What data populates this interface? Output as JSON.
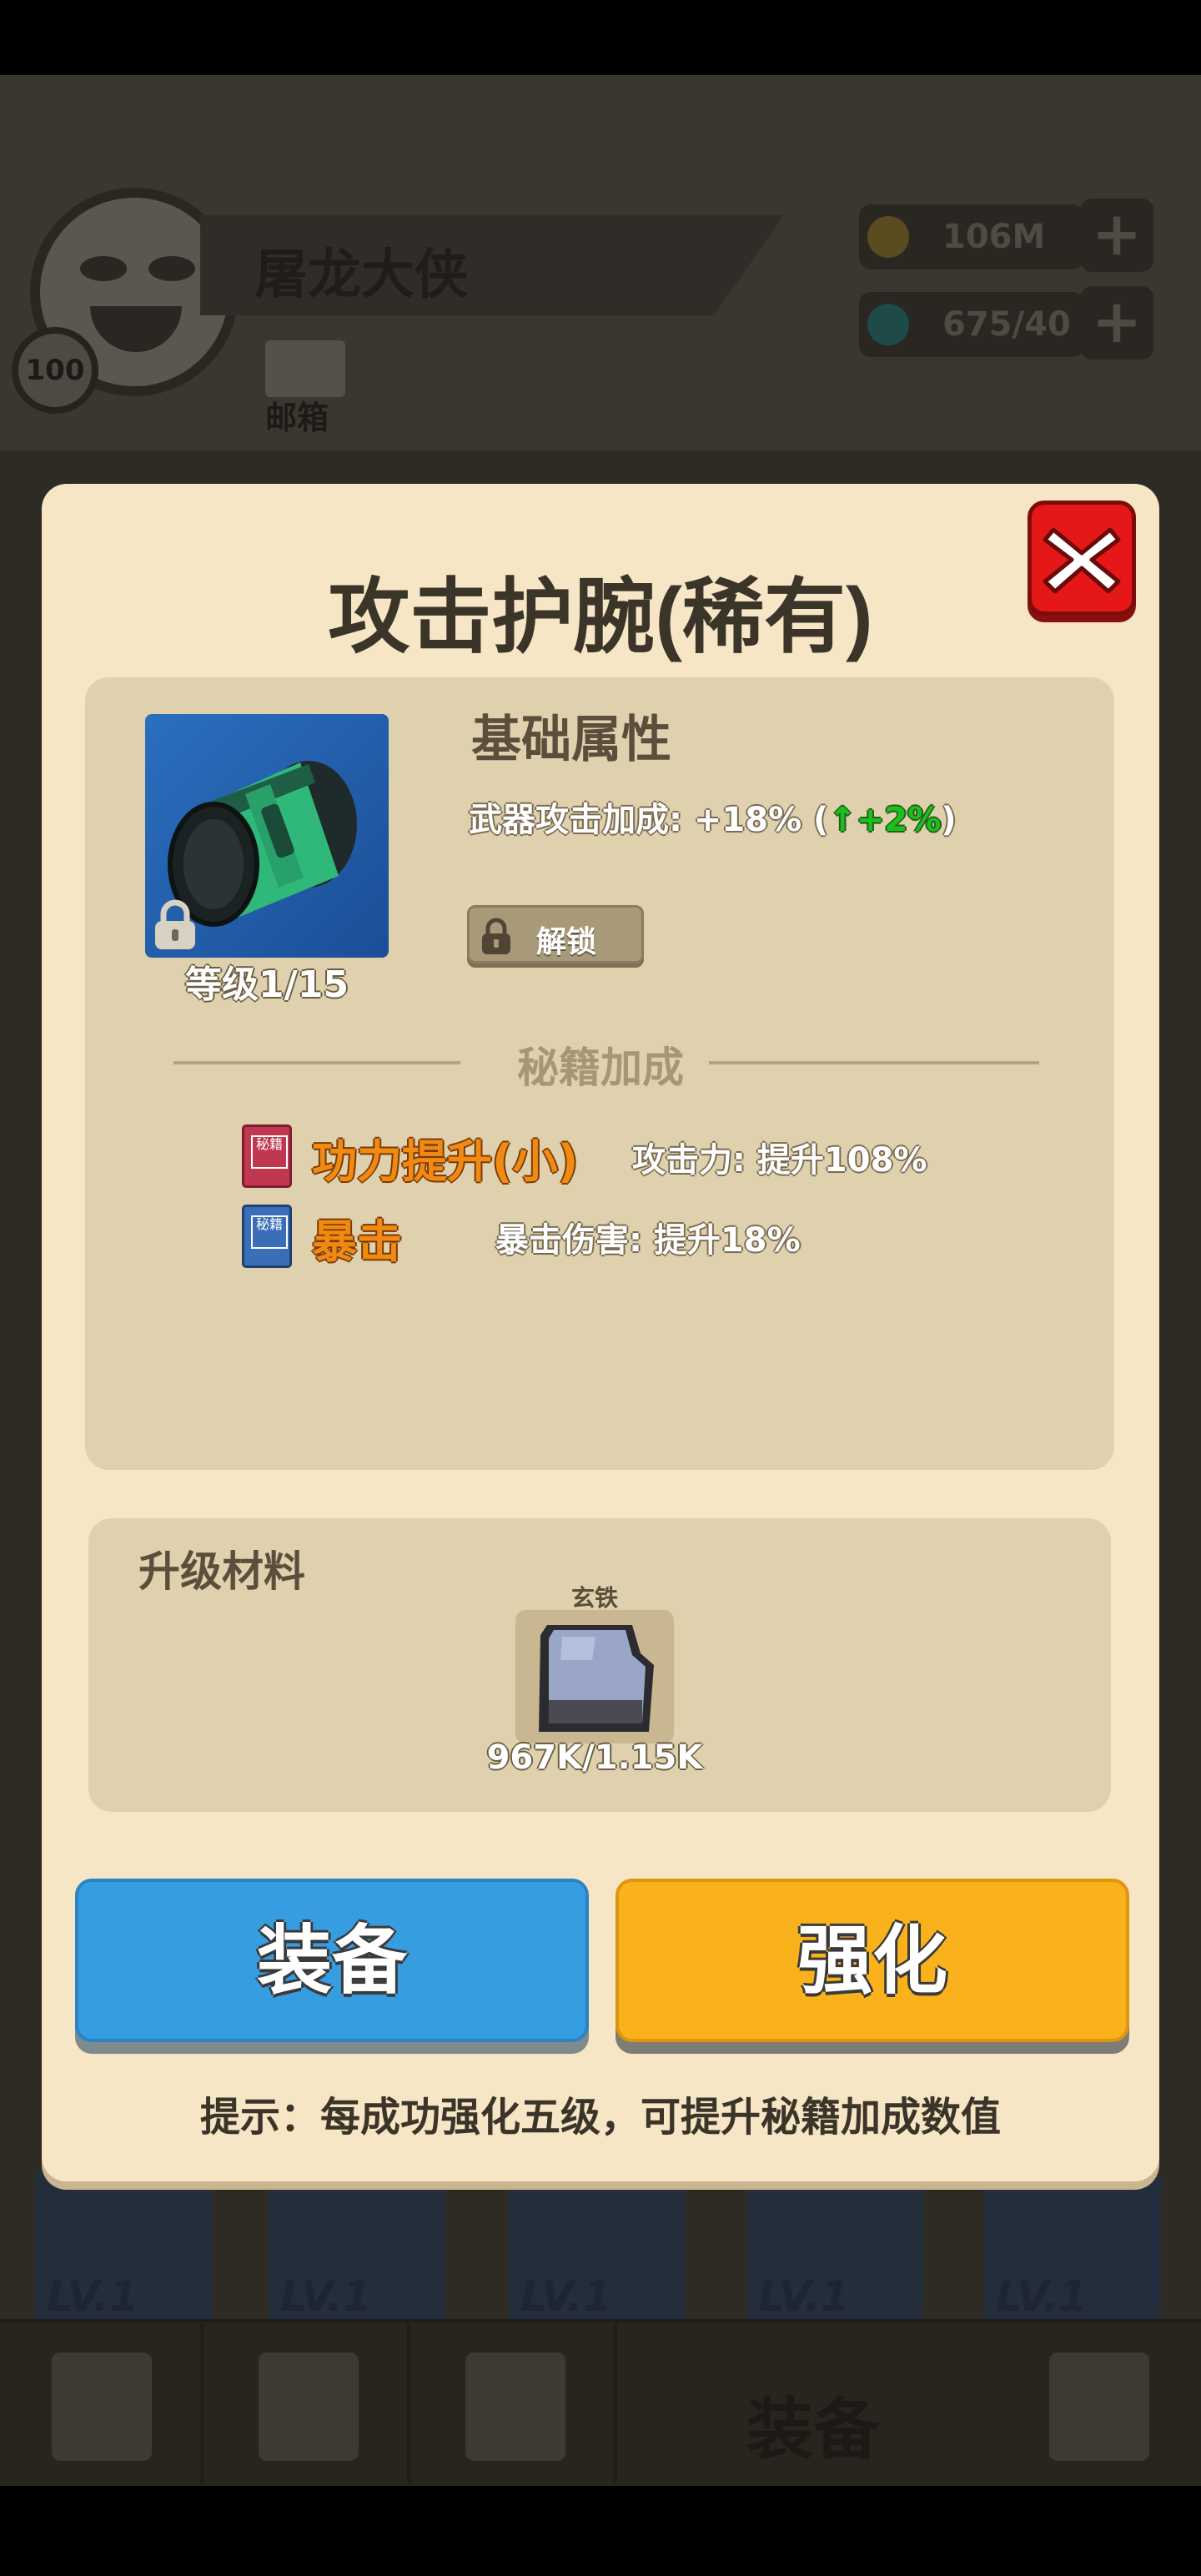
{
  "background": {
    "player_name": "屠龙大侠",
    "player_level": "100",
    "mail_label": "邮箱",
    "gold": "106M",
    "gems": "675/40",
    "slot_labels": [
      "LV.1",
      "LV.1",
      "LV.1",
      "LV.1",
      "LV.1"
    ],
    "nav_active_label": "装备"
  },
  "dialog": {
    "title": "攻击护腕(稀有)",
    "item_level": "等级1/15",
    "base_attr_title": "基础属性",
    "base_attr_text": "武器攻击加成: +18% (",
    "base_attr_up": "+2%",
    "base_attr_close": ")",
    "unlock_label": "解锁",
    "secret_bonus_title": "秘籍加成",
    "book_char": "秘籍",
    "skills": [
      {
        "name": "功力提升(小)",
        "desc": "攻击力: 提升108%",
        "book_color": "#c0384f"
      },
      {
        "name": "暴击",
        "desc": "暴击伤害: 提升18%",
        "book_color": "#3a6fb8"
      }
    ],
    "materials_title": "升级材料",
    "material_name": "玄铁",
    "material_count": "967K/1.15K",
    "equip_label": "装备",
    "enhance_label": "强化",
    "hint": "提示：每成功强化五级，可提升秘籍加成数值"
  },
  "colors": {
    "equip_button": "#359de0",
    "enhance_button": "#fab21c",
    "close_button": "#e51817",
    "accent_orange": "#f08a12",
    "up_green": "#17c21a"
  }
}
